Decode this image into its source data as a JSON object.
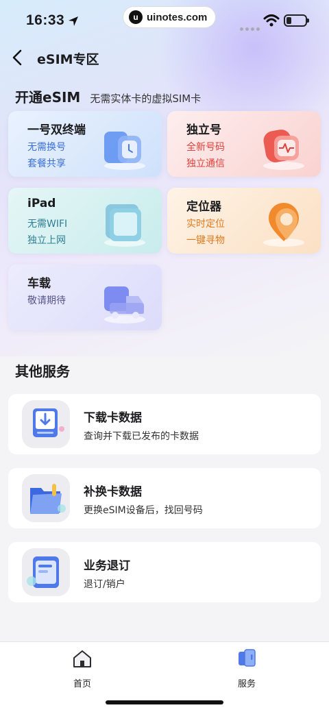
{
  "status_bar": {
    "time": "16:33",
    "watermark": "uinotes.com",
    "watermark_logo": "u"
  },
  "nav": {
    "title": "eSIM专区",
    "back_icon": "chevron-left-icon"
  },
  "esim_section": {
    "title": "开通eSIM",
    "subtitle": "无需实体卡的虚拟SIM卡",
    "cards": [
      {
        "title": "一号双终端",
        "line1": "无需换号",
        "line2": "套餐共享",
        "icon": "watch-phone-icon",
        "accent": "#3a6fd8"
      },
      {
        "title": "独立号",
        "line1": "全新号码",
        "line2": "独立通信",
        "icon": "heart-rate-watch-icon",
        "accent": "#e0403a"
      },
      {
        "title": "iPad",
        "line1": "无需WIFI",
        "line2": "独立上网",
        "icon": "tablet-icon",
        "accent": "#2f7e93"
      },
      {
        "title": "定位器",
        "line1": "实时定位",
        "line2": "一键寻物",
        "icon": "location-pin-icon",
        "accent": "#e07a1f"
      },
      {
        "title": "车载",
        "line1": "敬请期待",
        "line2": "",
        "icon": "truck-icon",
        "accent": "#55558a"
      }
    ]
  },
  "other_services": {
    "title": "其他服务",
    "items": [
      {
        "title": "下载卡数据",
        "desc": "查询并下载已发布的卡数据",
        "icon": "download-icon"
      },
      {
        "title": "补换卡数据",
        "desc": "更换eSIM设备后，找回号码",
        "icon": "folder-icon"
      },
      {
        "title": "业务退订",
        "desc": "退订/销户",
        "icon": "clipboard-icon"
      }
    ]
  },
  "tabbar": {
    "tabs": [
      {
        "label": "首页",
        "icon": "home-icon"
      },
      {
        "label": "服务",
        "icon": "service-icon"
      }
    ]
  }
}
